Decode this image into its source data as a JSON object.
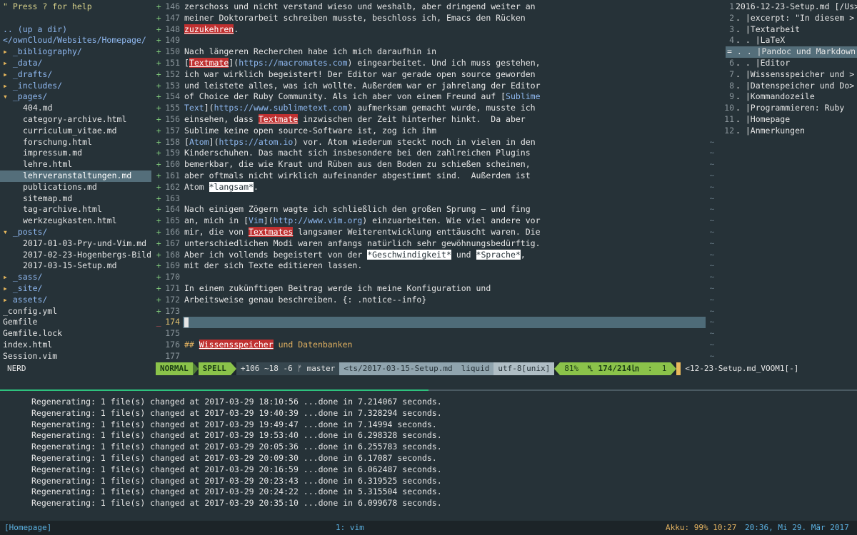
{
  "nerdtree": {
    "help": "\" Press ? for help",
    "up": ".. (up a dir)",
    "root": "</ownCloud/Websites/Homepage/",
    "items": [
      {
        "arrow": "▸",
        "name": "_bibliography/",
        "type": "dir",
        "indent": 0
      },
      {
        "arrow": "▸",
        "name": "_data/",
        "type": "dir",
        "indent": 0
      },
      {
        "arrow": "▸",
        "name": "_drafts/",
        "type": "dir",
        "indent": 0
      },
      {
        "arrow": "▸",
        "name": "_includes/",
        "type": "dir",
        "indent": 0
      },
      {
        "arrow": "▾",
        "name": "_pages/",
        "type": "dir",
        "indent": 0
      },
      {
        "arrow": "",
        "name": "404.md",
        "type": "file",
        "indent": 1
      },
      {
        "arrow": "",
        "name": "category-archive.html",
        "type": "file",
        "indent": 1
      },
      {
        "arrow": "",
        "name": "curriculum_vitae.md",
        "type": "file",
        "indent": 1
      },
      {
        "arrow": "",
        "name": "forschung.html",
        "type": "file",
        "indent": 1
      },
      {
        "arrow": "",
        "name": "impressum.md",
        "type": "file",
        "indent": 1
      },
      {
        "arrow": "",
        "name": "lehre.html",
        "type": "file",
        "indent": 1
      },
      {
        "arrow": "",
        "name": "lehrveranstaltungen.md",
        "type": "file",
        "indent": 1,
        "selected": true
      },
      {
        "arrow": "",
        "name": "publications.md",
        "type": "file",
        "indent": 1
      },
      {
        "arrow": "",
        "name": "sitemap.md",
        "type": "file",
        "indent": 1
      },
      {
        "arrow": "",
        "name": "tag-archive.html",
        "type": "file",
        "indent": 1
      },
      {
        "arrow": "",
        "name": "werkzeugkasten.html",
        "type": "file",
        "indent": 1
      },
      {
        "arrow": "▾",
        "name": "_posts/",
        "type": "dir",
        "indent": 0
      },
      {
        "arrow": "",
        "name": "2017-01-03-Pry-und-Vim.md",
        "type": "file",
        "indent": 1
      },
      {
        "arrow": "",
        "name": "2017-02-23-Hogenbergs-Bild>",
        "type": "file",
        "indent": 1
      },
      {
        "arrow": "",
        "name": "2017-03-15-Setup.md",
        "type": "file",
        "indent": 1
      },
      {
        "arrow": "▸",
        "name": "_sass/",
        "type": "dir",
        "indent": 0
      },
      {
        "arrow": "▸",
        "name": "_site/",
        "type": "dir",
        "indent": 0
      },
      {
        "arrow": "▸",
        "name": "assets/",
        "type": "dir",
        "indent": 0
      },
      {
        "arrow": "",
        "name": "_config.yml",
        "type": "file",
        "indent": 0
      },
      {
        "arrow": "",
        "name": "Gemfile",
        "type": "file",
        "indent": 0
      },
      {
        "arrow": "",
        "name": "Gemfile.lock",
        "type": "file",
        "indent": 0
      },
      {
        "arrow": "",
        "name": "index.html",
        "type": "file",
        "indent": 0
      },
      {
        "arrow": "",
        "name": "Session.vim",
        "type": "file",
        "indent": 0
      }
    ]
  },
  "editor": {
    "lines": [
      {
        "sign": "+",
        "num": "146",
        "segs": [
          {
            "t": "zerschoss und nicht verstand wieso und weshalb, aber dringend weiter an"
          }
        ]
      },
      {
        "sign": "+",
        "num": "147",
        "segs": [
          {
            "t": "meiner Doktorarbeit schreiben musste, beschloss ich, Emacs den Rücken"
          }
        ]
      },
      {
        "sign": "+",
        "num": "148",
        "segs": [
          {
            "t": "zuzukehren",
            "c": "spellbad"
          },
          {
            "t": "."
          }
        ]
      },
      {
        "sign": "+",
        "num": "149",
        "segs": []
      },
      {
        "sign": "+",
        "num": "150",
        "segs": [
          {
            "t": "Nach längeren Recherchen habe ich mich daraufhin in"
          }
        ]
      },
      {
        "sign": "+",
        "num": "151",
        "segs": [
          {
            "t": "["
          },
          {
            "t": "Textmate",
            "c": "spellbad"
          },
          {
            "t": "]("
          },
          {
            "t": "https://macromates.com",
            "c": "link"
          },
          {
            "t": ") eingearbeitet. Und ich muss gestehen,"
          }
        ]
      },
      {
        "sign": "+",
        "num": "152",
        "segs": [
          {
            "t": "ich war wirklich begeistert! Der Editor war gerade open source geworden"
          }
        ]
      },
      {
        "sign": "+",
        "num": "153",
        "segs": [
          {
            "t": "und leistete alles, was ich wollte. Außerdem war er jahrelang der Editor"
          }
        ]
      },
      {
        "sign": "+",
        "num": "154",
        "segs": [
          {
            "t": "of Choice der Ruby Community. Als ich aber von einem Freund auf ["
          },
          {
            "t": "Sublime",
            "c": "link"
          }
        ]
      },
      {
        "sign": "+",
        "num": "155",
        "segs": [
          {
            "t": "Text",
            "c": "link"
          },
          {
            "t": "]("
          },
          {
            "t": "https://www.sublimetext.com",
            "c": "link"
          },
          {
            "t": ") aufmerksam gemacht wurde, musste ich"
          }
        ]
      },
      {
        "sign": "+",
        "num": "156",
        "segs": [
          {
            "t": "einsehen, dass "
          },
          {
            "t": "Textmate",
            "c": "spellbad"
          },
          {
            "t": " inzwischen der Zeit hinterher hinkt.  Da aber"
          }
        ]
      },
      {
        "sign": "+",
        "num": "157",
        "segs": [
          {
            "t": "Sublime keine open source-Software ist, zog ich ihm"
          }
        ]
      },
      {
        "sign": "+",
        "num": "158",
        "segs": [
          {
            "t": "["
          },
          {
            "t": "Atom",
            "c": "link"
          },
          {
            "t": "]("
          },
          {
            "t": "https://atom.io",
            "c": "link"
          },
          {
            "t": ") vor. Atom wiederum steckt noch in vielen in den"
          }
        ]
      },
      {
        "sign": "+",
        "num": "159",
        "segs": [
          {
            "t": "Kinderschuhen. Das macht sich insbesondere bei den zahlreichen Plugins"
          }
        ]
      },
      {
        "sign": "+",
        "num": "160",
        "segs": [
          {
            "t": "bemerkbar, die wie Kraut und Rüben aus den Boden zu schießen scheinen,"
          }
        ]
      },
      {
        "sign": "+",
        "num": "161",
        "segs": [
          {
            "t": "aber oftmals nicht wirklich aufeinander abgestimmt sind.  Außerdem ist"
          }
        ]
      },
      {
        "sign": "+",
        "num": "162",
        "segs": [
          {
            "t": "Atom "
          },
          {
            "t": "*langsam*",
            "c": "italicmd"
          },
          {
            "t": "."
          }
        ]
      },
      {
        "sign": "+",
        "num": "163",
        "segs": []
      },
      {
        "sign": "+",
        "num": "164",
        "segs": [
          {
            "t": "Nach einigem Zögern wagte ich schließlich den großen Sprung – und fing"
          }
        ]
      },
      {
        "sign": "+",
        "num": "165",
        "segs": [
          {
            "t": "an, mich in ["
          },
          {
            "t": "Vim",
            "c": "link"
          },
          {
            "t": "]("
          },
          {
            "t": "http://www.vim.org",
            "c": "link"
          },
          {
            "t": ") einzuarbeiten. Wie viel andere vor"
          }
        ]
      },
      {
        "sign": "+",
        "num": "166",
        "segs": [
          {
            "t": "mir, die von "
          },
          {
            "t": "Textmates",
            "c": "spellbad"
          },
          {
            "t": " langsamer Weiterentwicklung enttäuscht waren. Die"
          }
        ]
      },
      {
        "sign": "+",
        "num": "167",
        "segs": [
          {
            "t": "unterschiedlichen Modi waren anfangs natürlich sehr gewöhnungsbedürftig."
          }
        ]
      },
      {
        "sign": "+",
        "num": "168",
        "segs": [
          {
            "t": "Aber ich vollends begeistert von der "
          },
          {
            "t": "*Geschwindigkeit*",
            "c": "italicmd"
          },
          {
            "t": " und "
          },
          {
            "t": "*Sprache*",
            "c": "italicmd"
          },
          {
            "t": ","
          }
        ]
      },
      {
        "sign": "+",
        "num": "169",
        "segs": [
          {
            "t": "mit der sich Texte editieren lassen."
          }
        ]
      },
      {
        "sign": "+",
        "num": "170",
        "segs": []
      },
      {
        "sign": "+",
        "num": "171",
        "segs": [
          {
            "t": "In einem zukünftigen Beitrag werde ich meine Konfiguration und"
          }
        ]
      },
      {
        "sign": "+",
        "num": "172",
        "segs": [
          {
            "t": "Arbeitsweise genau beschreiben. {: .notice--info}"
          }
        ]
      },
      {
        "sign": "+",
        "num": "173",
        "segs": []
      },
      {
        "sign": "_",
        "num": "174",
        "segs": [],
        "current": true
      },
      {
        "sign": "",
        "num": "175",
        "segs": []
      },
      {
        "sign": "",
        "num": "176",
        "segs": [
          {
            "t": "## ",
            "c": "heading"
          },
          {
            "t": "Wissensspeicher",
            "c": "spellbad"
          },
          {
            "t": " und Datenbanken",
            "c": "heading"
          }
        ]
      },
      {
        "sign": "",
        "num": "177",
        "segs": []
      }
    ]
  },
  "tilde_rows": [
    "",
    "",
    "",
    "",
    "",
    "",
    "",
    "",
    "",
    "",
    "",
    "",
    "~",
    "~",
    "~",
    "~",
    "~",
    "~",
    "~",
    "~",
    "~",
    "~",
    "~",
    "~",
    "~",
    "~",
    "~",
    "~",
    "~",
    "~",
    "~",
    "~"
  ],
  "voom": {
    "rows": [
      {
        "num": "1",
        "text": "2016-12-23-Setup.md [/Us>",
        "title": true
      },
      {
        "num": "2",
        "text": ". |excerpt: \"In diesem >"
      },
      {
        "num": "3",
        "text": ". |Textarbeit"
      },
      {
        "num": "4",
        "text": ". . |LaTeX"
      },
      {
        "num": "5",
        "text": "= . . |Pandoc und Markdown",
        "current": true
      },
      {
        "num": "6",
        "text": ". . |Editor"
      },
      {
        "num": "7",
        "text": ". |Wissensspeicher und >"
      },
      {
        "num": "8",
        "text": ". |Datenspeicher und Do>"
      },
      {
        "num": "9",
        "text": ". |Kommandozeile"
      },
      {
        "num": "10",
        "text": ". |Programmieren: Ruby"
      },
      {
        "num": "11",
        "text": ". |Homepage"
      },
      {
        "num": "12",
        "text": ". |Anmerkungen"
      }
    ]
  },
  "statusline": {
    "nerd": "NERD",
    "mode": "NORMAL",
    "spell": "SPELL",
    "git": "+106 ~18 -6 ᚠ master",
    "file": "<ts/2017-03-15-Setup.md",
    "filetype": "liquid",
    "encoding": "utf-8[unix]",
    "percent": "81%",
    "position": "␤ 174/214㏑",
    "column": ":  1",
    "voom_file": "<12-23-Setup.md_VOOM1[-]"
  },
  "terminal": {
    "lines": [
      "Regenerating: 1 file(s) changed at 2017-03-29 18:10:56 ...done in 7.214067 seconds.",
      "Regenerating: 1 file(s) changed at 2017-03-29 19:40:39 ...done in 7.328294 seconds.",
      "Regenerating: 1 file(s) changed at 2017-03-29 19:49:47 ...done in 7.14994 seconds.",
      "Regenerating: 1 file(s) changed at 2017-03-29 19:53:40 ...done in 6.298328 seconds.",
      "Regenerating: 1 file(s) changed at 2017-03-29 20:05:36 ...done in 6.255783 seconds.",
      "Regenerating: 1 file(s) changed at 2017-03-29 20:09:30 ...done in 6.17087 seconds.",
      "Regenerating: 1 file(s) changed at 2017-03-29 20:16:59 ...done in 6.062487 seconds.",
      "Regenerating: 1 file(s) changed at 2017-03-29 20:23:43 ...done in 6.319525 seconds.",
      "Regenerating: 1 file(s) changed at 2017-03-29 20:24:22 ...done in 5.315504 seconds.",
      "Regenerating: 1 file(s) changed at 2017-03-29 20:35:10 ...done in 6.099678 seconds."
    ]
  },
  "tmux": {
    "session": "[Homepage]",
    "window": "1: vim",
    "akku": "Akku: 99% 10:27",
    "clock": "20:36, Mi 29. Mär 2017"
  }
}
